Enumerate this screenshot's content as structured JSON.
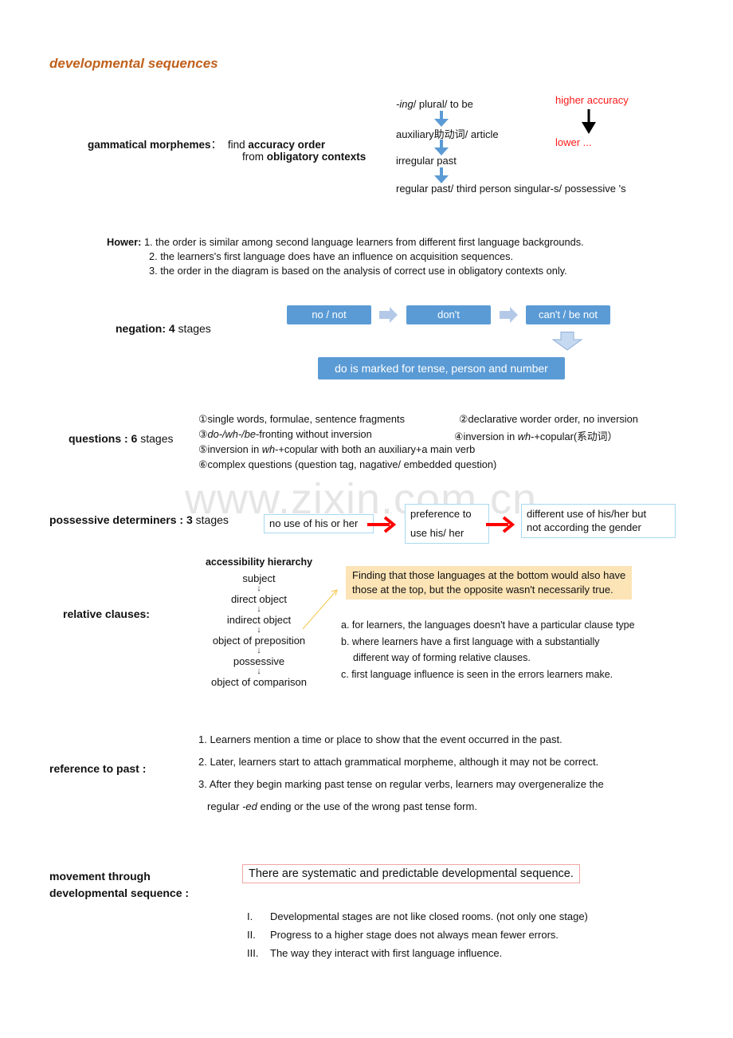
{
  "title": "developmental sequences",
  "colors": {
    "title": "#c0601c",
    "accent_red": "#ff1a1a",
    "negation_box": "#5b9bd5",
    "note_bg": "#fce4b6",
    "possessive_border": "#a8daf0",
    "systematic_border": "#f2a4a4"
  },
  "watermark": "www.zixin.com.cn",
  "morphemes": {
    "label": "gammatical morphemes",
    "colon": "：",
    "desc_pre": "find ",
    "desc_bold1": "accuracy order",
    "desc_pre2": "from ",
    "desc_bold2": "obligatory contexts",
    "sequence": [
      {
        "italic": "-ing",
        "rest": "/ plural/ to be"
      },
      {
        "italic": "",
        "rest": "auxiliary助动词/ article"
      },
      {
        "italic": "",
        "rest": "irregular past"
      },
      {
        "italic": "",
        "rest": "regular past/ third person singular-s/ possessive 's"
      }
    ],
    "higher": "higher accuracy",
    "lower": "lower ..."
  },
  "however": {
    "label": "Hower:",
    "items": [
      "1. the order is similar among second language learners from different first language backgrounds.",
      "2. the learners's first language does have an influence on acquisition sequences.",
      "3. the order in the diagram is based on the analysis of correct use in obligatory contexts only."
    ]
  },
  "negation": {
    "label_bold": "negation: 4",
    "label_rest": " stages",
    "stages": [
      "no / not",
      "don't",
      "can't / be not",
      "do is marked for tense, person and number"
    ]
  },
  "questions": {
    "label_bold": "questions :  6",
    "label_rest": "  stages",
    "s1": "①single words, formulae, sentence fragments",
    "s2": "②declarative worder order, no inversion",
    "s3_italic": "do-/wh-/be",
    "s3_pre": "③",
    "s3_rest": "-fronting without inversion",
    "s4_pre": "④inversion in ",
    "s4_italic": "wh",
    "s4_rest": "-+copular(系动词）",
    "s5_pre": "⑤inversion in ",
    "s5_italic": "wh",
    "s5_rest": "-+copular with both an auxiliary+a main verb",
    "s6": "⑥complex questions (question tag, nagative/ embedded question)"
  },
  "possessive": {
    "label_bold": "possessive determiners : 3",
    "label_rest": " stages",
    "stages": [
      {
        "line1": "no use of his or her",
        "line2": ""
      },
      {
        "line1": "preference to",
        "line2": "use his/ her"
      },
      {
        "line1": "different use of his/her but",
        "line2": "not according the gender"
      }
    ]
  },
  "relative": {
    "label": "relative clauses:",
    "hierarchy_title": "accessibility hierarchy",
    "hierarchy": [
      "subject",
      "direct object",
      "indirect object",
      "object of preposition",
      "possessive",
      "object of comparison"
    ],
    "arrow_glyph": "↓",
    "note": [
      "Finding that those languages at the bottom would also have",
      "those at the top, but the opposite wasn't necessarily true."
    ],
    "points": [
      "a. for learners, the languages doesn't have a particular clause type",
      "b. where learners have a first language with a substantially",
      "different way of forming relative clauses.",
      "c. first language influence is seen in the errors learners make."
    ]
  },
  "past": {
    "label": "reference to past :",
    "items": [
      "1. Learners mention a time or place to show that the event occurred in the past.",
      "2. Later, learners start to attach grammatical morpheme, although it may not be correct.",
      "3. After they begin marking past tense on regular verbs, learners may overgeneralize the"
    ],
    "item3_cont_pre": "regular ",
    "item3_cont_italic": "-ed",
    "item3_cont_rest": " ending or the use of the wrong past tense form."
  },
  "movement": {
    "label_line1": "movement through",
    "label_line2": "developmental sequence :",
    "statement": "There are systematic and predictable developmental sequence.",
    "points": [
      {
        "num": "I.",
        "text": "Developmental stages are not like closed rooms. (not only one stage)"
      },
      {
        "num": "II.",
        "text": "Progress to a higher stage does not always mean fewer errors."
      },
      {
        "num": "III.",
        "text": "The way they interact with first language influence."
      }
    ]
  }
}
